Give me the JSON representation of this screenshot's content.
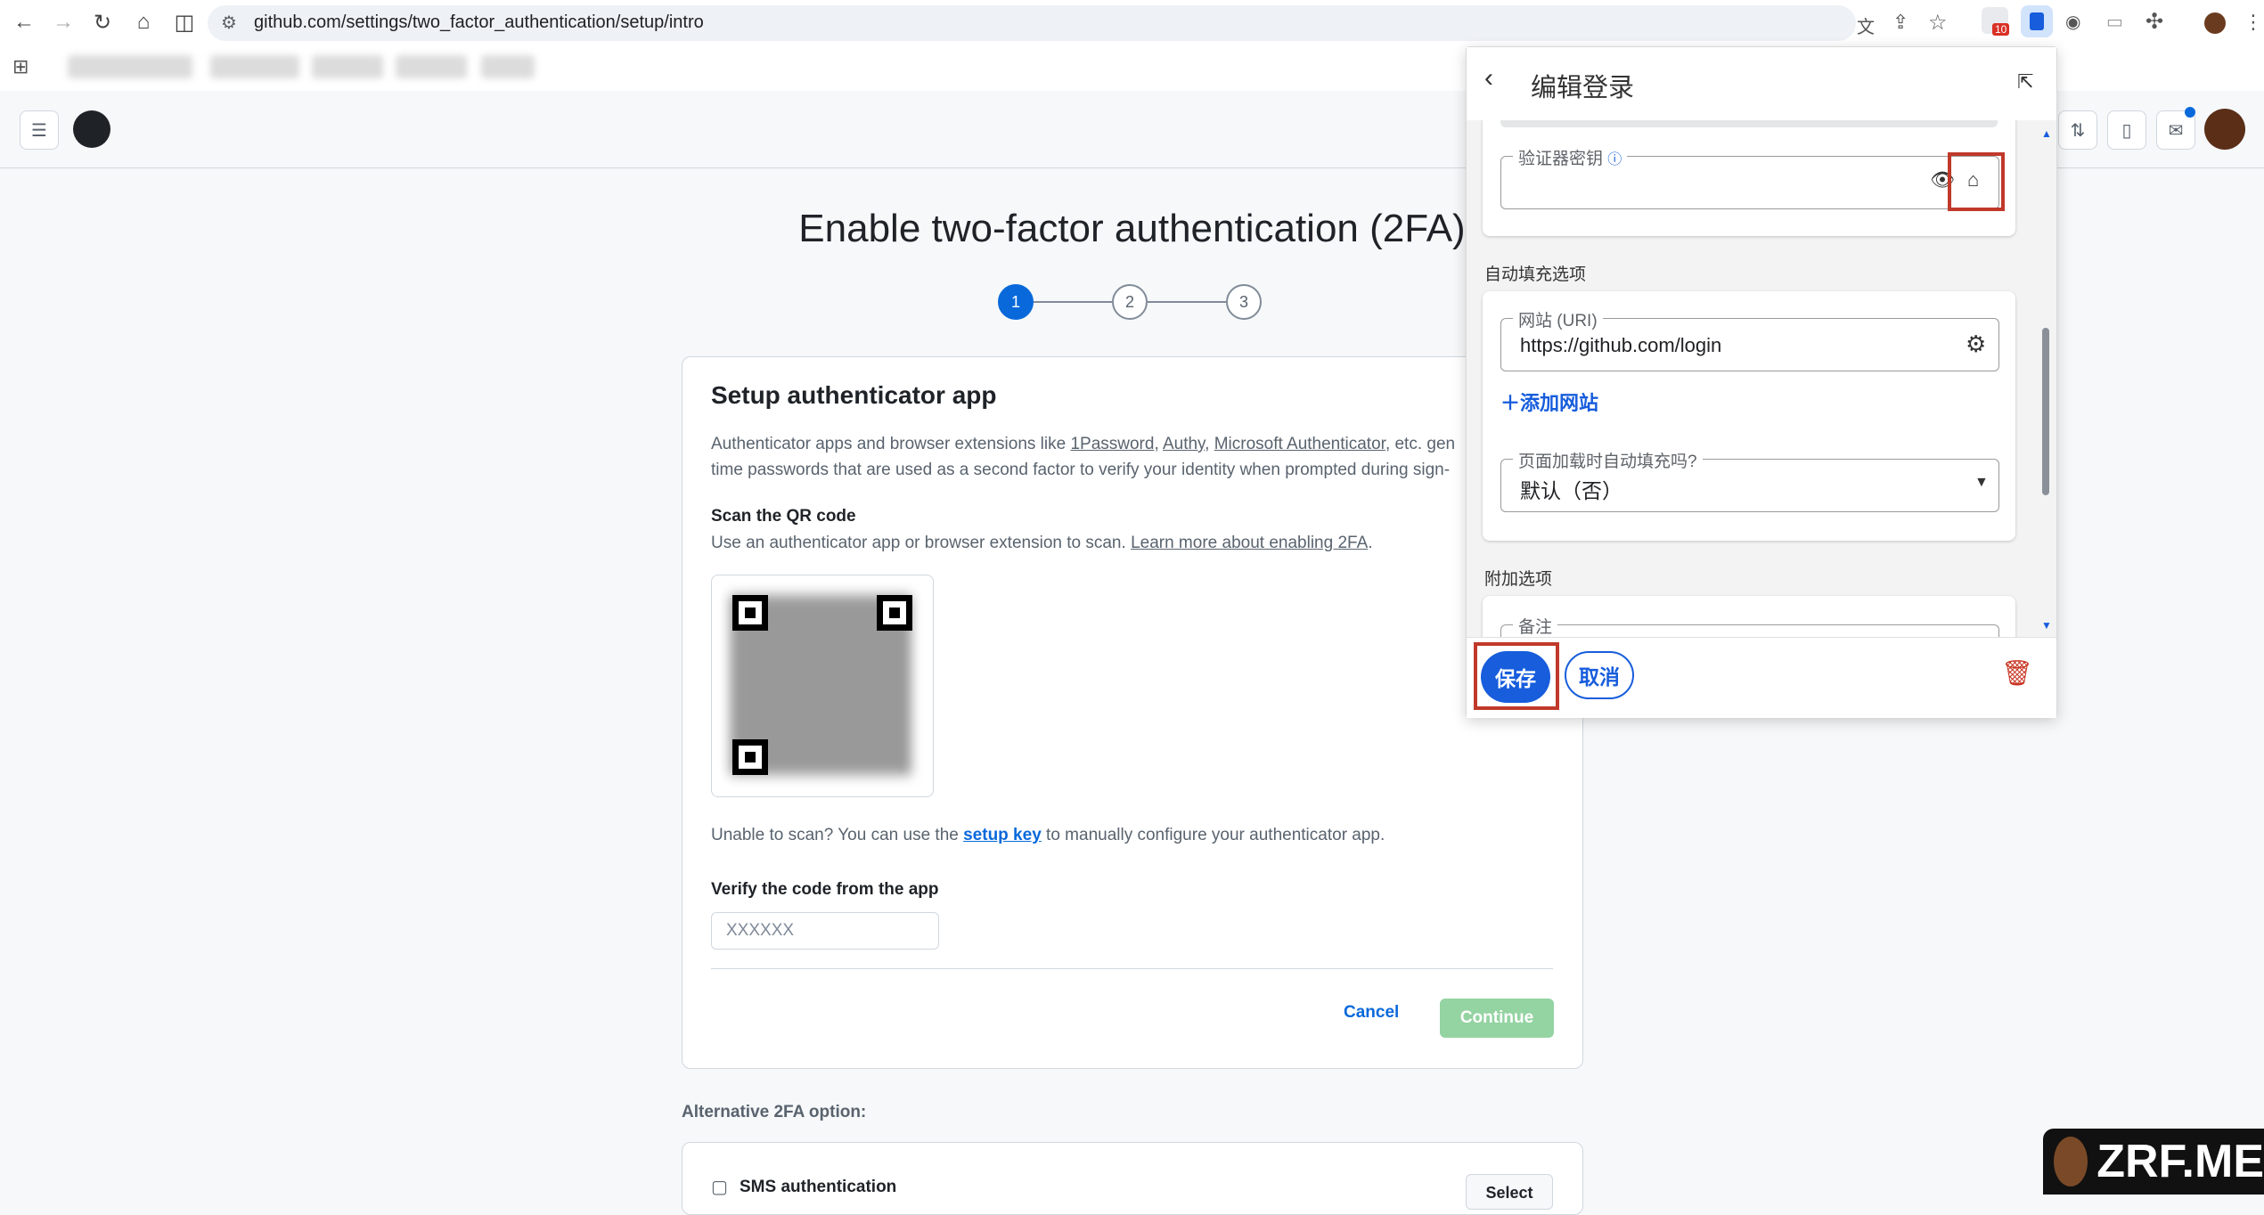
{
  "browser": {
    "url": "github.com/settings/two_factor_authentication/setup/intro",
    "extension_badge": "10"
  },
  "github": {
    "page_title": "Enable two-factor authentication (2FA)",
    "steps": [
      "1",
      "2",
      "3"
    ],
    "card_title": "Setup authenticator app",
    "intro": {
      "prefix": "Authenticator apps and browser extensions like ",
      "app1": "1Password",
      "sep1": ", ",
      "app2": "Authy",
      "sep2": ", ",
      "app3": "Microsoft Authenticator",
      "suffix": ", etc. gen",
      "line2": "time passwords that are used as a second factor to verify your identity when prompted during sign-"
    },
    "scan_heading": "Scan the QR code",
    "scan_text": "Use an authenticator app or browser extension to scan. ",
    "scan_link": "Learn more about enabling 2FA",
    "scan_end": ".",
    "unable_prefix": "Unable to scan? You can use the ",
    "setup_key": "setup key",
    "unable_suffix": " to manually configure your authenticator app.",
    "verify_label": "Verify the code from the app",
    "code_placeholder": "XXXXXX",
    "cancel": "Cancel",
    "continue": "Continue",
    "alt_label": "Alternative 2FA option:",
    "sms_label": "SMS authentication",
    "select": "Select"
  },
  "popup": {
    "title": "编辑登录",
    "authenticator_key_label": "验证器密钥",
    "autofill_section": "自动填充选项",
    "uri_label": "网站 (URI)",
    "uri_value": "https://github.com/login",
    "add_site": "添加网站",
    "autofill_on_load_label": "页面加载时自动填充吗?",
    "autofill_on_load_value": "默认（否）",
    "extra_section": "附加选项",
    "notes_label": "备注",
    "save": "保存",
    "cancel": "取消"
  },
  "watermark": "ZRF.ME",
  "colors": {
    "accent": "#0969da",
    "popup_accent": "#175ddc",
    "highlight": "#c0392b",
    "continue_disabled": "#94d3a2"
  }
}
